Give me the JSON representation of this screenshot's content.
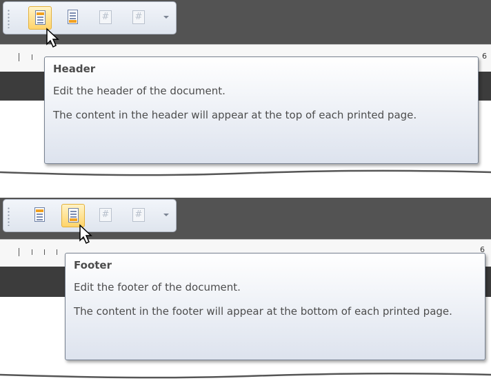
{
  "header_example": {
    "tooltip": {
      "title": "Header",
      "description": "Edit the header of the document.",
      "details": "The content in the header will appear at the top of each printed page."
    },
    "active_button": "header",
    "ruler_numbers": [
      "6"
    ]
  },
  "footer_example": {
    "tooltip": {
      "title": "Footer",
      "description": "Edit the footer of the document.",
      "details": "The content in the footer will appear at the bottom of each printed page."
    },
    "active_button": "footer",
    "ruler_numbers": [
      "6"
    ]
  },
  "toolbar_buttons": [
    {
      "name": "header",
      "icon": "header-page-icon"
    },
    {
      "name": "footer",
      "icon": "footer-page-icon"
    },
    {
      "name": "page-number",
      "icon": "page-number-icon"
    },
    {
      "name": "page-count",
      "icon": "page-count-icon"
    }
  ],
  "colors": {
    "dark_bar": "#535353",
    "active_highlight": "#ffd46a",
    "tooltip_border": "#76808f"
  }
}
